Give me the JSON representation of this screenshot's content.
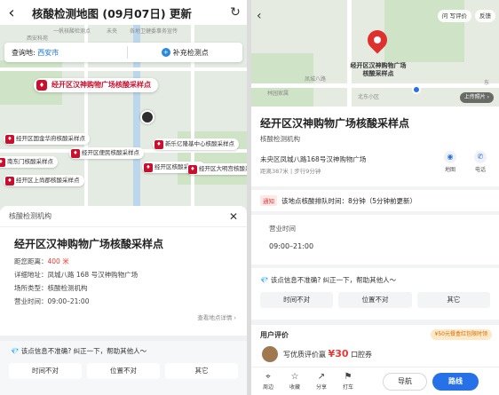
{
  "left": {
    "header": {
      "back": "‹",
      "title": "核酸检测地图 (09月07日) 更新",
      "refresh": "↻"
    },
    "filter": {
      "city_label": "查询地:",
      "city_value": "西安市",
      "add_label": "补充检测点"
    },
    "map_labels": [
      "一帆核酸检测点",
      "未央",
      "各地卫健委事务宣传",
      "西安科苑"
    ],
    "pins": [
      "经开区国金华府核酸采样点",
      "经开区便民核酸采样点",
      "经开区核酸采样点",
      "新乐亿隆基中心核酸采样点",
      "经开区大明宫核酸采样点",
      "南东门核酸采样点",
      "经开区上尚郡核酸采样点"
    ],
    "main_pin": "经开区汉神购物广场核酸采样点",
    "card": {
      "header": "核酸检测机构",
      "close": "✕",
      "name": "经开区汉神购物广场核酸采样点",
      "distance_label": "距您距离：",
      "distance_value": "400 米",
      "address": "详细地址：凤城八路 168 号汉神购物广场",
      "type": "场所类型：核酸检测机构",
      "hours": "营业时间：09:00–21:00",
      "more": "查看地点详情 ›"
    },
    "feedback": {
      "title": "该点信息不准确? 纠正一下，帮助其他人～",
      "buttons": [
        "时间不对",
        "位置不对",
        "其它"
      ]
    }
  },
  "right": {
    "top_buttons": [
      "问 写评价",
      "反馈"
    ],
    "pin_label": "经开区汉神购物广场核酸采样点",
    "map_labels": [
      "林园家属",
      "凤城八路",
      "北东小区",
      "东"
    ],
    "photo_btn": "上传照片 ›",
    "name": "经开区汉神购物广场核酸采样点",
    "type": "核酸检测机构",
    "address": "未央区凤城八路168号汉神购物广场",
    "distance": "距离387米 | 步行9分钟",
    "icons": [
      {
        "glyph": "◉",
        "label": "地图"
      },
      {
        "glyph": "✆",
        "label": "电话"
      }
    ],
    "notice": {
      "tag": "通知",
      "text": "该地点核酸排队时间：8分钟（5分钟前更新）"
    },
    "hours": {
      "label": "营业时间",
      "value": "09:00–21:00"
    },
    "feedback": {
      "title": "该点信息不准确? 纠正一下，帮助其他人～",
      "buttons": [
        "时间不对",
        "位置不对",
        "其它"
      ]
    },
    "review": {
      "title": "用户评价",
      "promo": "¥50元餐盒红包限时领",
      "write_prefix": "写优质评价赢",
      "amount": "¥30",
      "write_suffix": "口腔券"
    },
    "bottom": {
      "items": [
        {
          "glyph": "⌖",
          "label": "周边"
        },
        {
          "glyph": "☆",
          "label": "收藏"
        },
        {
          "glyph": "↗",
          "label": "分享"
        },
        {
          "glyph": "⚑",
          "label": "打车"
        }
      ],
      "nav": "导航",
      "route": "路线"
    }
  }
}
